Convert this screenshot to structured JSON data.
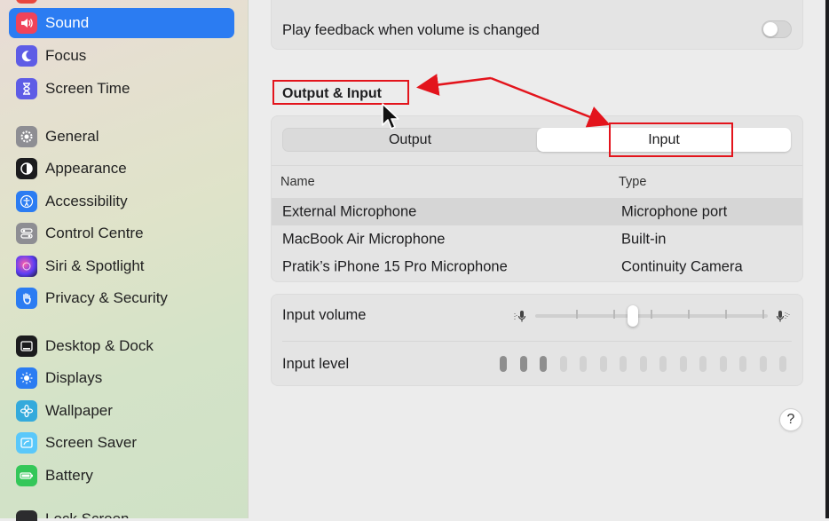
{
  "sidebar": {
    "active": "Sound",
    "items": [
      {
        "label": "Sound",
        "icon": "speaker-icon",
        "color": "#f0435a"
      },
      {
        "label": "Focus",
        "icon": "moon-icon",
        "color": "#5e5ce6"
      },
      {
        "label": "Screen Time",
        "icon": "hourglass-icon",
        "color": "#5e5ce6"
      },
      {
        "label": "General",
        "icon": "gear-icon",
        "color": "#8e8e93"
      },
      {
        "label": "Appearance",
        "icon": "appearance-icon",
        "color": "#1c1c1e"
      },
      {
        "label": "Accessibility",
        "icon": "accessibility-icon",
        "color": "#2b7cf2"
      },
      {
        "label": "Control Centre",
        "icon": "control-centre-icon",
        "color": "#8e8e93"
      },
      {
        "label": "Siri & Spotlight",
        "icon": "siri-icon",
        "color": "#2a2a3a"
      },
      {
        "label": "Privacy & Security",
        "icon": "hand-icon",
        "color": "#2b7cf2"
      },
      {
        "label": "Desktop & Dock",
        "icon": "dock-icon",
        "color": "#1c1c1e"
      },
      {
        "label": "Displays",
        "icon": "sun-icon",
        "color": "#2b7cf2"
      },
      {
        "label": "Wallpaper",
        "icon": "flower-icon",
        "color": "#34aadc"
      },
      {
        "label": "Screen Saver",
        "icon": "screensaver-icon",
        "color": "#5ac8fa"
      },
      {
        "label": "Battery",
        "icon": "battery-icon",
        "color": "#34c759"
      }
    ],
    "partial_bottom_label": "Lock Screen"
  },
  "main": {
    "feedback_label": "Play feedback when volume is changed",
    "feedback_enabled": false,
    "section_title": "Output & Input",
    "tabs": [
      {
        "label": "Output",
        "selected": false
      },
      {
        "label": "Input",
        "selected": true
      }
    ],
    "table": {
      "headers": [
        "Name",
        "Type"
      ],
      "rows": [
        {
          "name": "External Microphone",
          "type": "Microphone port",
          "selected": true
        },
        {
          "name": "MacBook Air Microphone",
          "type": "Built-in",
          "selected": false
        },
        {
          "name": "Pratik’s iPhone 15 Pro Microphone",
          "type": "Continuity Camera",
          "selected": false
        }
      ]
    },
    "input_volume_label": "Input volume",
    "input_volume": 0.42,
    "input_level_label": "Input level",
    "input_level_segments": 15,
    "input_level_active": 3,
    "help_label": "?"
  },
  "colors": {
    "accent": "#2b7cf2",
    "annotation": "#e3141c"
  }
}
